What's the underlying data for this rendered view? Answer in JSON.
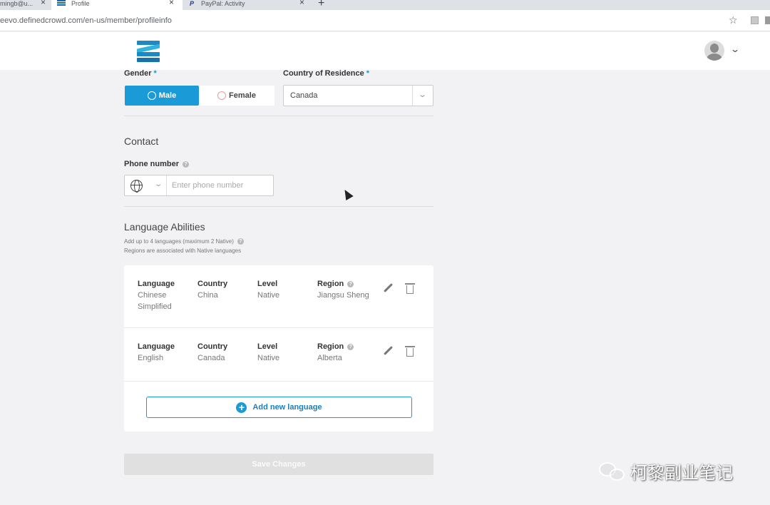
{
  "browser": {
    "tabs": [
      {
        "label": "mingb@u...",
        "close": "×"
      },
      {
        "label": "Profile",
        "close": "×"
      },
      {
        "label": "PayPal: Activity",
        "close": "×"
      }
    ],
    "new_tab": "+",
    "url": "eevo.definedcrowd.com/en-us/member/profileinfo",
    "star_icon": "☆"
  },
  "header": {
    "avatar_chevron": "⌄"
  },
  "personal": {
    "gender_label": "Gender",
    "required_mark": "*",
    "gender_options": [
      "Male",
      "Female"
    ],
    "gender_selected": "Male",
    "country_label": "Country of Residence",
    "country_value": "Canada"
  },
  "contact": {
    "title": "Contact",
    "phone_label": "Phone number",
    "phone_placeholder": "Enter phone number"
  },
  "languages": {
    "title": "Language Abilities",
    "hint1": "Add up to 4 languages (maximum 2 Native)",
    "hint2": "Regions are associated with Native languages",
    "headers": {
      "language": "Language",
      "country": "Country",
      "level": "Level",
      "region": "Region"
    },
    "rows": [
      {
        "language": "Chinese Simplified",
        "country": "China",
        "level": "Native",
        "region": "Jiangsu Sheng"
      },
      {
        "language": "English",
        "country": "Canada",
        "level": "Native",
        "region": "Alberta"
      }
    ],
    "add_button": "Add new language"
  },
  "save_button": "Save Changes",
  "watermark": "柯黎副业笔记",
  "colors": {
    "accent": "#1a9bd7",
    "background": "#f2f2f4"
  }
}
